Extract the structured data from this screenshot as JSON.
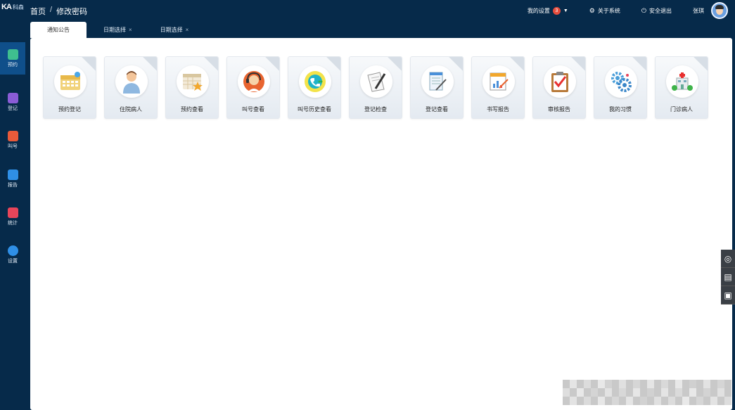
{
  "logo": {
    "mark": "KA",
    "name": "科森"
  },
  "breadcrumb": {
    "home": "首页",
    "sep": "/",
    "current": "修改密码"
  },
  "header": {
    "my_settings": "我的设置",
    "my_settings_badge": "3",
    "about": "关于系统",
    "logout": "安全退出",
    "user_name": "张琪"
  },
  "sidebar": {
    "items": [
      {
        "label": "预约",
        "icon": "calendar-icon",
        "color": "#3fbf8f"
      },
      {
        "label": "登记",
        "icon": "register-icon",
        "color": "#8a5cd6"
      },
      {
        "label": "叫号",
        "icon": "call-number-icon",
        "color": "#e85a3a"
      },
      {
        "label": "报告",
        "icon": "report-icon",
        "color": "#2f8fe6"
      },
      {
        "label": "统计",
        "icon": "statistics-icon",
        "color": "#e8455a"
      },
      {
        "label": "设置",
        "icon": "settings-icon",
        "color": "#2f8fe6"
      }
    ]
  },
  "tabs": [
    {
      "label": "通知公告",
      "closable": false
    },
    {
      "label": "日期选择",
      "close": "×"
    },
    {
      "label": "日期选择",
      "close": "×"
    }
  ],
  "tiles": [
    {
      "label": "预约登记",
      "icon": "calendar-icon"
    },
    {
      "label": "住院病人",
      "icon": "inpatient-icon"
    },
    {
      "label": "预约查看",
      "icon": "calendar-star-icon"
    },
    {
      "label": "叫号查看",
      "icon": "operator-icon"
    },
    {
      "label": "叫号历史查看",
      "icon": "call-history-icon"
    },
    {
      "label": "登记检查",
      "icon": "pen-paper-icon"
    },
    {
      "label": "登记查看",
      "icon": "document-edit-icon"
    },
    {
      "label": "书写报告",
      "icon": "write-report-icon"
    },
    {
      "label": "审核报告",
      "icon": "clipboard-check-icon"
    },
    {
      "label": "我的习惯",
      "icon": "gears-icon"
    },
    {
      "label": "门诊病人",
      "icon": "clinic-icon"
    }
  ],
  "float_buttons": [
    {
      "icon": "film-icon"
    },
    {
      "icon": "printer-icon"
    },
    {
      "icon": "scanner-icon"
    }
  ],
  "colors": {
    "bg": "#062a4a",
    "accent": "#0f4f8a",
    "badge": "#e64c3c"
  }
}
